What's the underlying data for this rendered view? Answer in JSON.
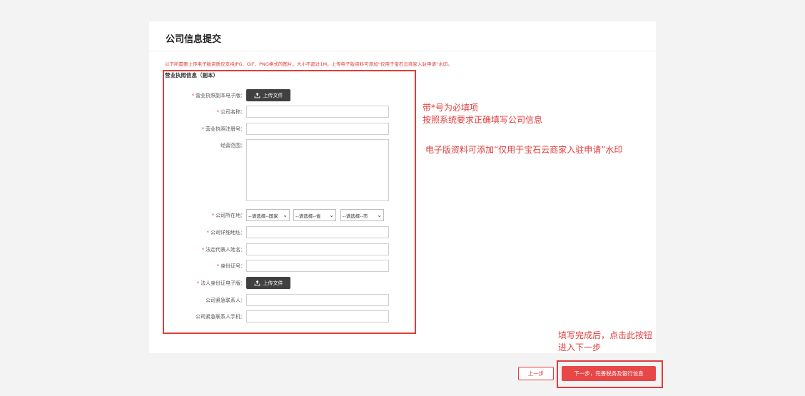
{
  "page": {
    "title": "公司信息提交",
    "notice": "以下所需要上传电子版资质仅支持JPG、GIF、PNG格式的图片，大小不超过1M。上传电子版资料可添加“仅用于宝石云商家入驻申请”水印。",
    "section_title": "营业执照信息（副本）"
  },
  "form": {
    "required_mark": "*",
    "upload_label": "上传文件",
    "fields": {
      "license_image": "营业执照副本电子版：",
      "company_name": "公司名称：",
      "reg_number": "营业执照注册号：",
      "business_scope": "经营范围：",
      "location": "公司所在地：",
      "address": "公司详细地址：",
      "legal_rep_name": "法定代表人姓名：",
      "id_number": "身份证号：",
      "legal_id_image": "法人身份证电子版：",
      "emergency_contact": "公司紧急联系人：",
      "emergency_phone": "公司紧急联系人手机："
    },
    "selects": {
      "country": "--请选择--国家",
      "province": "--请选择--省",
      "city": "--请选择--市"
    }
  },
  "annotations": {
    "required_note_1": "带*号为必填项",
    "required_note_2": "按照系统要求正确填写公司信息",
    "watermark_note": "电子版资料可添加“仅用于宝石云商家入驻申请”水印",
    "next_note_1": "填写完成后，点击此按钮",
    "next_note_2": "进入下一步"
  },
  "buttons": {
    "prev": "上一步",
    "next": "下一步，完善税务及银行信息"
  },
  "colors": {
    "accent": "#e03c3c",
    "button_primary": "#e84747",
    "upload_button": "#404040"
  }
}
